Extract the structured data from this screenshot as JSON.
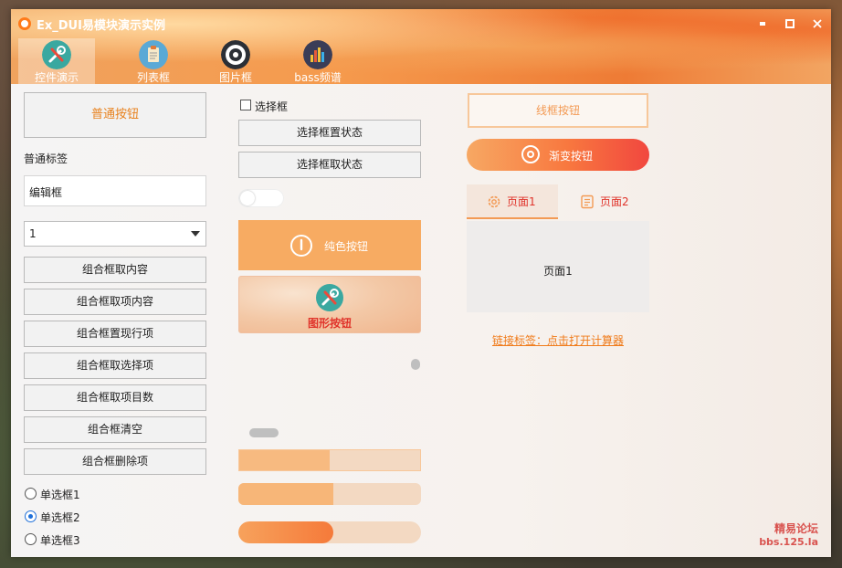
{
  "window": {
    "title": "Ex_DUI易模块演示实例",
    "minimize_glyph": "▪",
    "maximize_glyph": "▫",
    "close_glyph": "✕"
  },
  "nav_tabs": [
    {
      "label": "控件演示",
      "icon": "tools-icon",
      "active": true
    },
    {
      "label": "列表框",
      "icon": "clipboard-icon",
      "active": false
    },
    {
      "label": "图片框",
      "icon": "camera-aperture-icon",
      "active": false
    },
    {
      "label": "bass频谱",
      "icon": "equalizer-icon",
      "active": false
    }
  ],
  "left": {
    "normal_button": "普通按钮",
    "normal_label": "普通标签",
    "edit_box_value": "编辑框",
    "combo_value": "1",
    "combo_buttons": [
      "组合框取内容",
      "组合框取项内容",
      "组合框置现行项",
      "组合框取选择项",
      "组合框取项目数",
      "组合框清空",
      "组合框删除项"
    ],
    "radios": [
      {
        "label": "单选框1",
        "checked": false
      },
      {
        "label": "单选框2",
        "checked": true
      },
      {
        "label": "单选框3",
        "checked": false
      }
    ]
  },
  "middle": {
    "checkbox_label": "选择框",
    "checkbox_checked": false,
    "set_state_button": "选择框置状态",
    "get_state_button": "选择框取状态",
    "toggle_on": false,
    "solid_button": "纯色按钮",
    "image_button": "图形按钮",
    "progress_values": [
      0.5,
      0.52,
      0.52
    ]
  },
  "right": {
    "outline_button": "线框按钮",
    "gradient_button": "渐变按钮",
    "page_tabs": [
      "页面1",
      "页面2"
    ],
    "page_content": "页面1",
    "link_label": "链接标签：点击打开计算器"
  },
  "watermark": {
    "line1": "精易论坛",
    "line2": "bbs.125.la"
  },
  "colors": {
    "accent": "#f7a25c",
    "link": "#f07b1a",
    "danger": "#e0332a",
    "radio": "#1e6fd9"
  }
}
